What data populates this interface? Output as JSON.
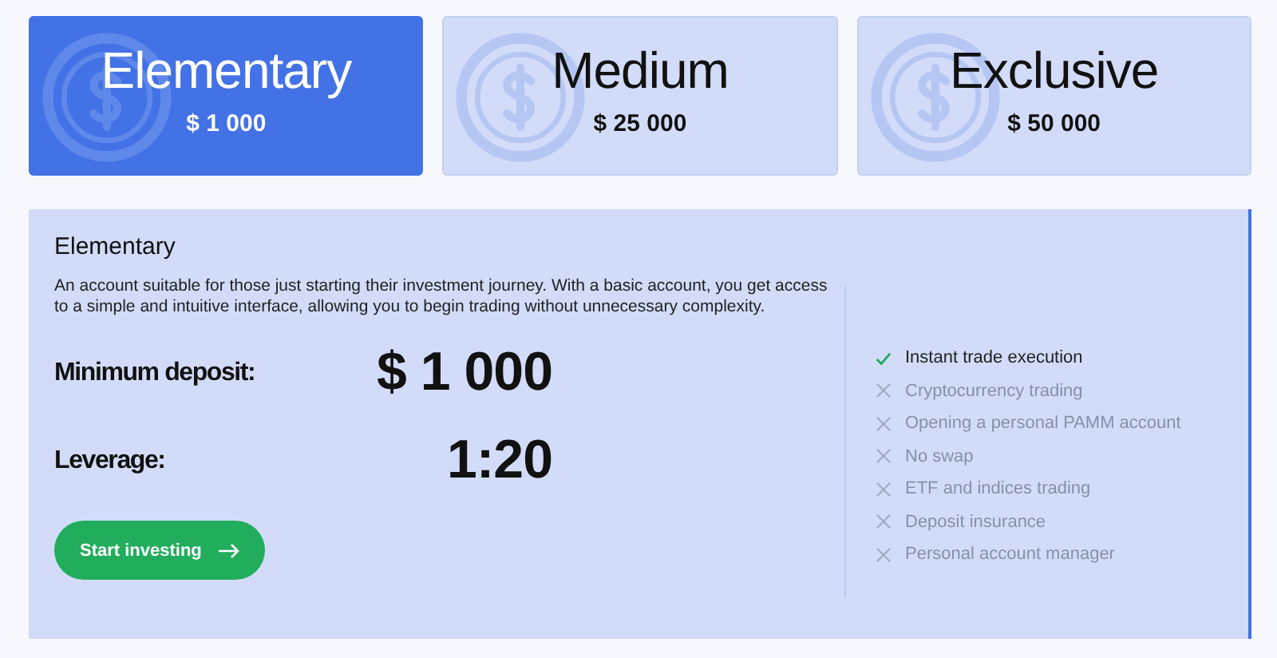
{
  "plans": [
    {
      "name": "Elementary",
      "price": "$ 1 000",
      "selected": true
    },
    {
      "name": "Medium",
      "price": "$ 25 000",
      "selected": false
    },
    {
      "name": "Exclusive",
      "price": "$ 50 000",
      "selected": false
    }
  ],
  "details": {
    "title": "Elementary",
    "description": "An account suitable for those just starting their investment journey. With a basic account, you get access to a simple and intuitive interface, allowing you to begin trading without unnecessary complexity.",
    "stats": [
      {
        "label": "Minimum deposit:",
        "value": "$ 1 000"
      },
      {
        "label": "Leverage:",
        "value": "1:20"
      }
    ],
    "button": "Start investing",
    "features": [
      {
        "text": "Instant trade execution",
        "included": true
      },
      {
        "text": "Cryptocurrency trading",
        "included": false
      },
      {
        "text": "Opening a personal PAMM account",
        "included": false
      },
      {
        "text": "No swap",
        "included": false
      },
      {
        "text": "ETF and indices trading",
        "included": false
      },
      {
        "text": "Deposit insurance",
        "included": false
      },
      {
        "text": "Personal account manager",
        "included": false
      }
    ]
  }
}
